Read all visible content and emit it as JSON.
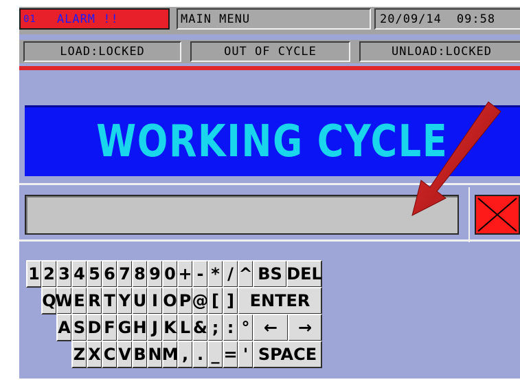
{
  "header": {
    "station_no": "01",
    "alarm_label": "ALARM !!",
    "menu_title": "MAIN MENU",
    "date": "20/09/14",
    "time": "09:58"
  },
  "status": {
    "load": "LOAD:LOCKED",
    "cycle": "OUT OF CYCLE",
    "unload": "UNLOAD:LOCKED"
  },
  "banner": {
    "title": "WORKING CYCLE"
  },
  "input": {
    "value": ""
  },
  "close_button": {
    "icon": "close-icon",
    "color": "#ff1a1a"
  },
  "keyboard": {
    "row1": [
      "1",
      "2",
      "3",
      "4",
      "5",
      "6",
      "7",
      "8",
      "9",
      "0",
      "+",
      "-",
      "*",
      "/",
      "^",
      "BS",
      "DEL"
    ],
    "row2": [
      "Q",
      "W",
      "E",
      "R",
      "T",
      "Y",
      "U",
      "I",
      "O",
      "P",
      "@",
      "[",
      "]",
      "ENTER"
    ],
    "row3": [
      "A",
      "S",
      "D",
      "F",
      "G",
      "H",
      "J",
      "K",
      "L",
      "&",
      ";",
      ":",
      "°",
      "←",
      "→"
    ],
    "row4": [
      "Z",
      "X",
      "C",
      "V",
      "B",
      "N",
      "M",
      ",",
      ".",
      "_",
      "=",
      "'",
      "SPACE"
    ]
  },
  "colors": {
    "alarm": "#e8202a",
    "banner_bg": "#0a14f5",
    "banner_text": "#19d6ec",
    "panel": "#9ea6d8",
    "annotation_arrow": "#d42020"
  }
}
